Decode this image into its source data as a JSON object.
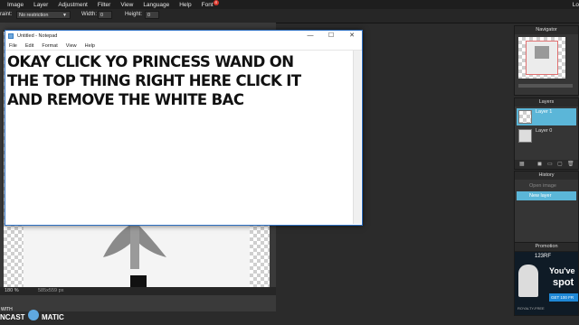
{
  "menubar": {
    "items": [
      "Image",
      "Layer",
      "Adjustment",
      "Filter",
      "View",
      "Language",
      "Help",
      "Font"
    ],
    "font_badge": "4",
    "right_text": "Lo"
  },
  "toolbar": {
    "constraint_label": "raint:",
    "constraint_value": "No restriction",
    "width_label": "Width:",
    "width_value": "0",
    "height_label": "Height:",
    "height_value": "0"
  },
  "canvas": {
    "zoom": "180",
    "zoom_unit": "%",
    "dimensions": "585x559 px"
  },
  "notepad": {
    "title": "Untitled - Notepad",
    "menu": [
      "File",
      "Edit",
      "Format",
      "View",
      "Help"
    ],
    "text": "OKAY CLICK YO PRINCESS WAND ON\nTHE TOP THING RIGHT HERE CLICK IT\nAND REMOVE THE WHITE BAC"
  },
  "navigator": {
    "title": "Navigator"
  },
  "layers": {
    "title": "Layers",
    "items": [
      {
        "label": "Layer 1",
        "selected": true
      },
      {
        "label": "Layer 0",
        "selected": false
      }
    ]
  },
  "history": {
    "title": "History",
    "items": [
      {
        "label": "Open image",
        "selected": false
      },
      {
        "label": "New layer",
        "selected": true
      }
    ]
  },
  "promotion": {
    "title": "Promotion",
    "brand": "123RF",
    "headline_1": "You've",
    "headline_2": "spot",
    "button": "GET 100 FR",
    "footer": "ROYALTY-FREE"
  },
  "watermark": {
    "text_1": "WITH",
    "text_2": "NCAST",
    "text_3": "MATIC"
  },
  "colors": {
    "accent": "#5bb6d8",
    "notepad_border": "#2d6fc1",
    "badge": "#d9362b"
  }
}
